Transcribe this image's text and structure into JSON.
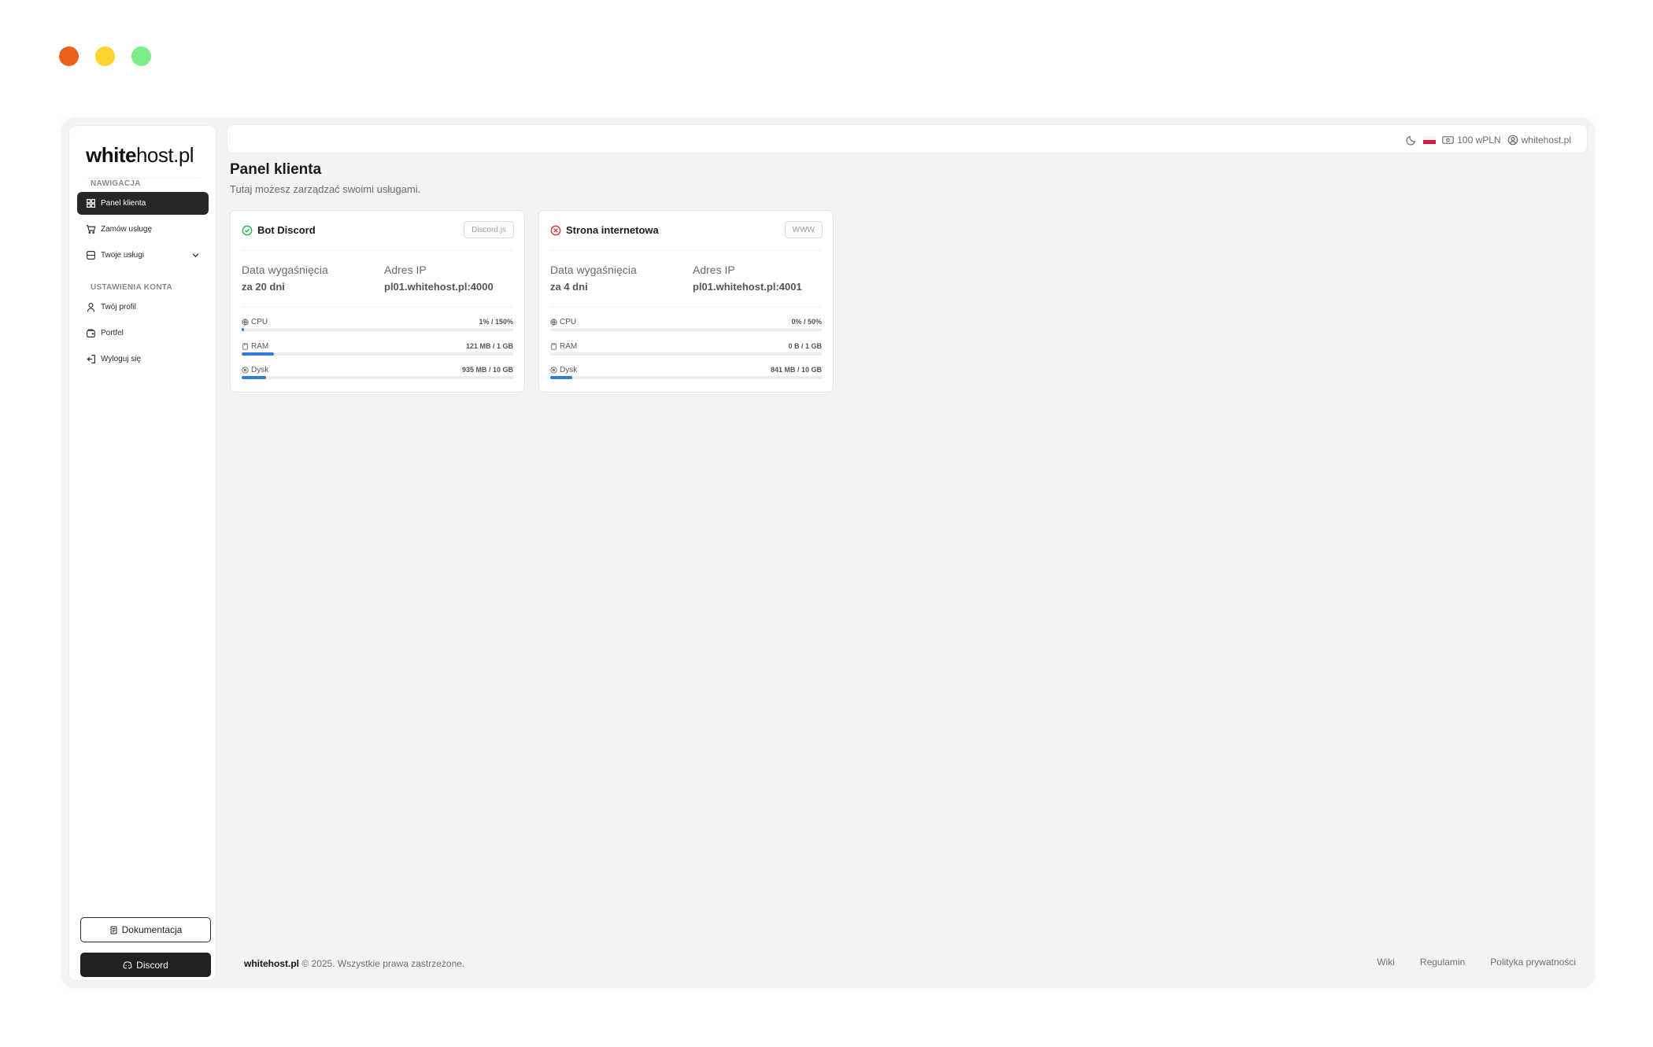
{
  "window": {
    "controls": [
      "close",
      "minimize",
      "maximize"
    ]
  },
  "brand": {
    "bold": "white",
    "rest": "host.pl"
  },
  "sidebar": {
    "nav_heading": "NAWIGACJA",
    "nav_items": [
      {
        "label": "Panel klienta",
        "icon": "dashboard-icon",
        "active": true
      },
      {
        "label": "Zamów usługę",
        "icon": "cart-icon"
      },
      {
        "label": "Twoje usługi",
        "icon": "server-icon",
        "expandable": true
      }
    ],
    "account_heading": "USTAWIENIA KONTA",
    "account_items": [
      {
        "label": "Twój profil",
        "icon": "user-icon"
      },
      {
        "label": "Portfel",
        "icon": "wallet-icon"
      },
      {
        "label": "Wyloguj się",
        "icon": "logout-icon"
      }
    ],
    "doc_button": "Dokumentacja",
    "discord_button": "Discord"
  },
  "topbar": {
    "balance": "100 wPLN",
    "user": "whitehost.pl"
  },
  "page": {
    "title": "Panel klienta",
    "subtitle": "Tutaj możesz zarządzać swoimi usługami."
  },
  "services": [
    {
      "name": "Bot Discord",
      "status": "online",
      "status_color": "#2fb344",
      "tag": "Discord.js",
      "expiry_label": "Data wygaśnięcia",
      "expiry_value": "za 20 dni",
      "ip_label": "Adres IP",
      "ip_value": "pl01.whitehost.pl:4000",
      "metrics": [
        {
          "label": "CPU",
          "value": "1% / 150%",
          "percent": 1
        },
        {
          "label": "RAM",
          "value": "121 MB / 1 GB",
          "percent": 12
        },
        {
          "label": "Dysk",
          "value": "935 MB / 10 GB",
          "percent": 9
        }
      ]
    },
    {
      "name": "Strona internetowa",
      "status": "offline",
      "status_color": "#d63939",
      "tag": "WWW",
      "expiry_label": "Data wygaśnięcia",
      "expiry_value": "za 4 dni",
      "ip_label": "Adres IP",
      "ip_value": "pl01.whitehost.pl:4001",
      "metrics": [
        {
          "label": "CPU",
          "value": "0% / 50%",
          "percent": 0
        },
        {
          "label": "RAM",
          "value": "0 B / 1 GB",
          "percent": 0
        },
        {
          "label": "Dysk",
          "value": "841 MB / 10 GB",
          "percent": 8
        }
      ]
    }
  ],
  "footer": {
    "brand": "whitehost.pl",
    "copyright": "© 2025. Wszystkie prawa zastrzeżone.",
    "links": [
      "Wiki",
      "Regulamin",
      "Polityka prywatności"
    ]
  }
}
